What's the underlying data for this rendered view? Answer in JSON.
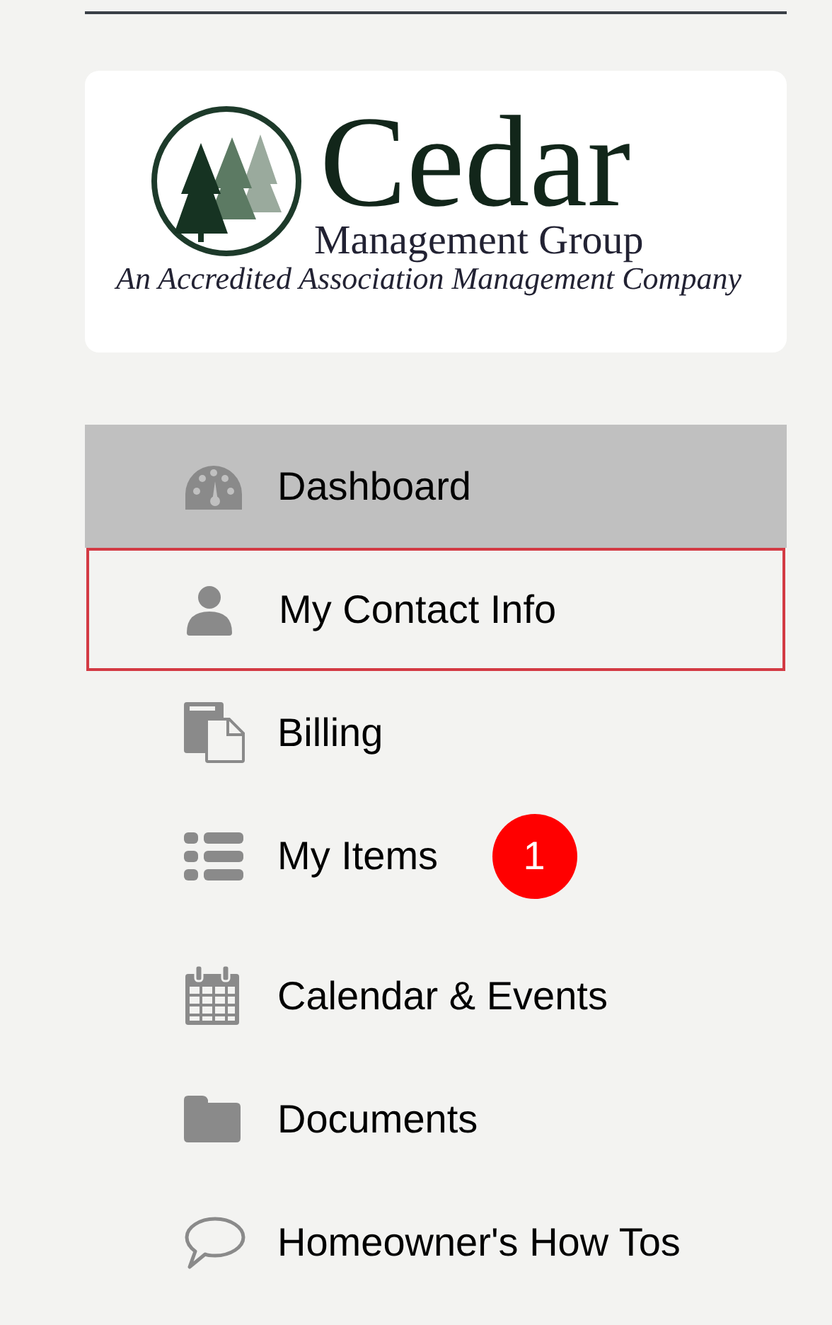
{
  "logo": {
    "name": "Cedar",
    "subtitle": "Management Group",
    "tagline": "An Accredited Association Management Company"
  },
  "menu": [
    {
      "label": "Dashboard",
      "selected": true,
      "focused": false
    },
    {
      "label": "My Contact Info",
      "selected": false,
      "focused": true
    },
    {
      "label": "Billing",
      "selected": false,
      "focused": false
    },
    {
      "label": "My Items",
      "selected": false,
      "focused": false,
      "badge": "1"
    },
    {
      "label": "Calendar & Events",
      "selected": false,
      "focused": false
    },
    {
      "label": "Documents",
      "selected": false,
      "focused": false
    },
    {
      "label": "Homeowner's How Tos",
      "selected": false,
      "focused": false
    }
  ]
}
